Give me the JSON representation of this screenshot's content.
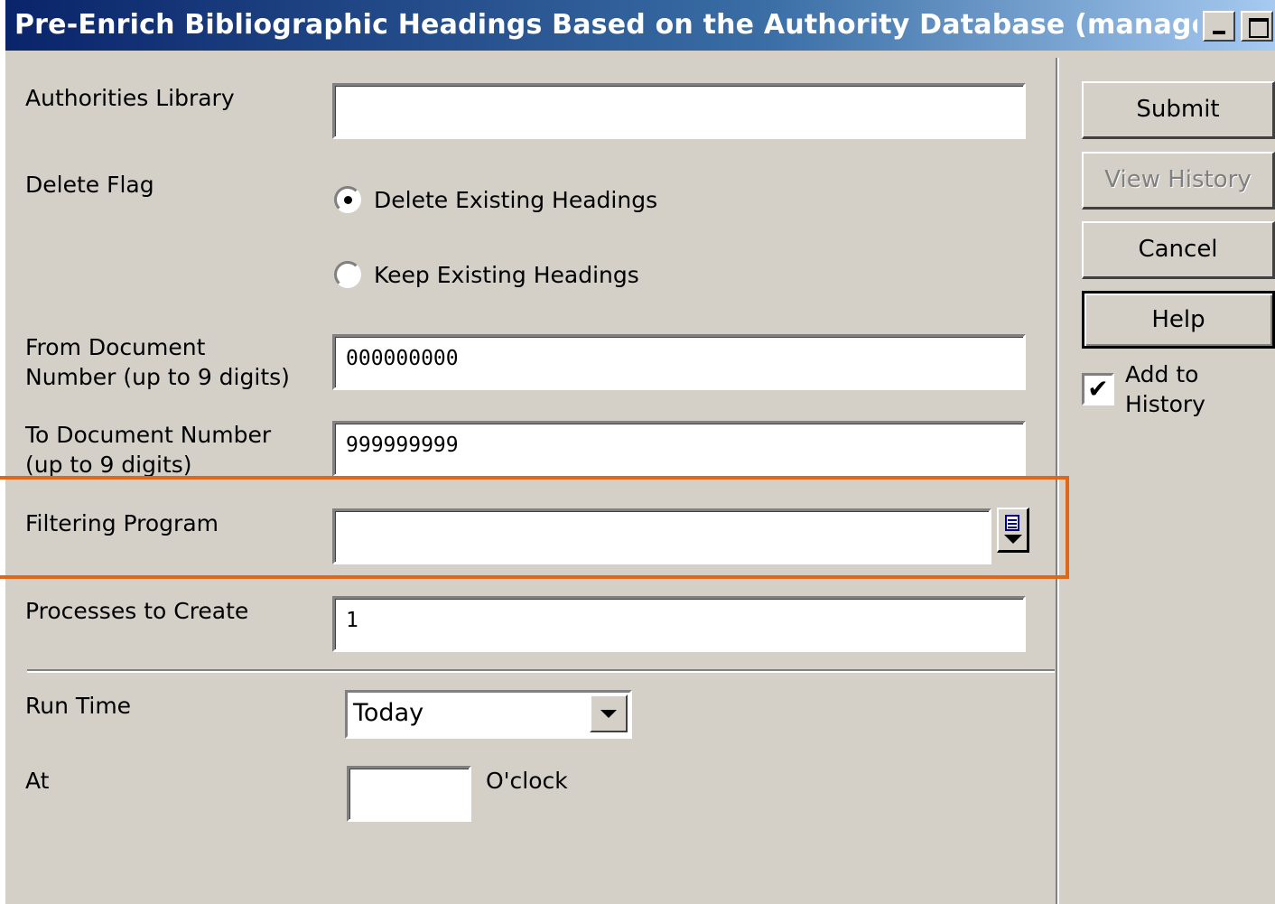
{
  "window": {
    "title": "Pre-Enrich Bibliographic Headings Based on the Authority Database (manage-..."
  },
  "form": {
    "authorities_library": {
      "label": "Authorities Library",
      "value": ""
    },
    "delete_flag": {
      "label": "Delete Flag",
      "options": [
        {
          "label": "Delete Existing Headings",
          "selected": true
        },
        {
          "label": "Keep Existing Headings",
          "selected": false
        }
      ]
    },
    "from_doc": {
      "label_line1": "From Document",
      "label_line2": "Number (up to 9 digits)",
      "value": "000000000"
    },
    "to_doc": {
      "label_line1": "To Document Number",
      "label_line2": "(up to 9 digits)",
      "value": "999999999"
    },
    "filtering_program": {
      "label": "Filtering Program",
      "value": ""
    },
    "processes": {
      "label": "Processes to Create",
      "value": "1"
    },
    "run_time": {
      "label": "Run Time",
      "selected": "Today"
    },
    "at": {
      "label": "At",
      "value": "",
      "suffix": "O'clock"
    }
  },
  "buttons": {
    "submit": "Submit",
    "view_history": "View History",
    "cancel": "Cancel",
    "help": "Help"
  },
  "add_to_history": {
    "line1": "Add to",
    "line2": "History",
    "checked": true
  },
  "colors": {
    "highlight": "#e0661a",
    "title_bar": "#0a246a",
    "panel": "#d4d0c8"
  }
}
